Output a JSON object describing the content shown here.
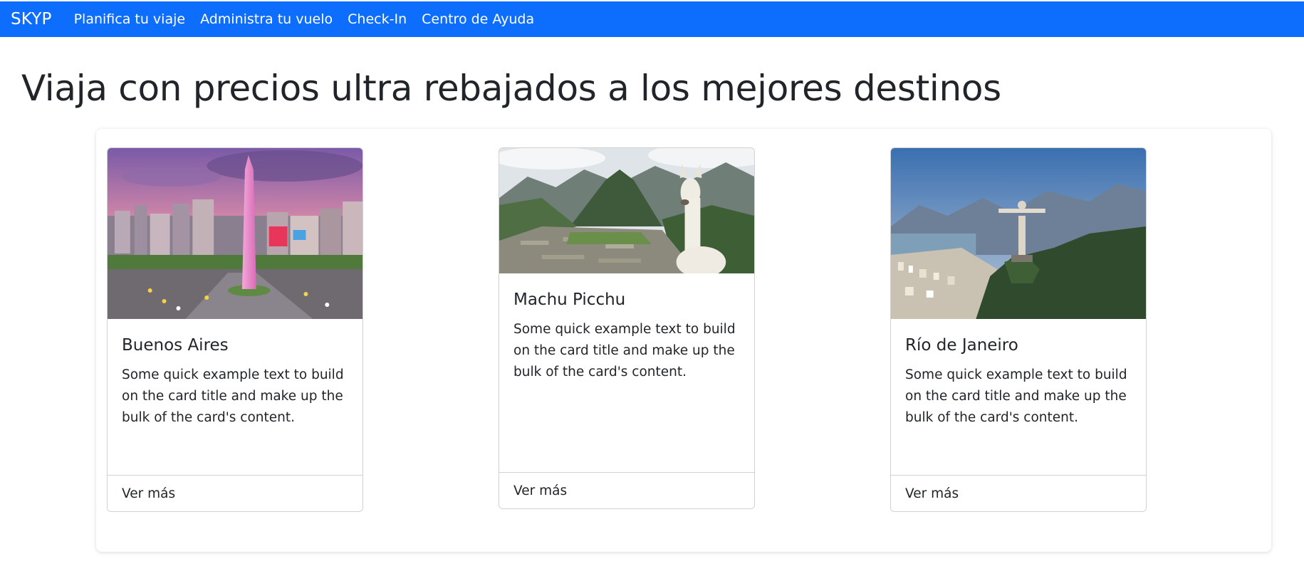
{
  "navbar": {
    "brand": "SKYP",
    "links": [
      "Planifica tu viaje",
      "Administra tu vuelo",
      "Check-In",
      "Centro de Ayuda"
    ],
    "background": "#0d6efd"
  },
  "page": {
    "title": "Viaja con precios ultra rebajados a los mejores destinos"
  },
  "cards": [
    {
      "title": "Buenos Aires",
      "text": "Some quick example text to build on the card title and make up the bulk of the card's content.",
      "footer": "Ver más",
      "image": "buenos-aires-obelisk-photo"
    },
    {
      "title": "Machu Picchu",
      "text": "Some quick example text to build on the card title and make up the bulk of the card's content.",
      "footer": "Ver más",
      "image": "machu-picchu-llama-photo"
    },
    {
      "title": "Río de Janeiro",
      "text": "Some quick example text to build on the card title and make up the bulk of the card's content.",
      "footer": "Ver más",
      "image": "rio-christ-redeemer-photo"
    }
  ]
}
